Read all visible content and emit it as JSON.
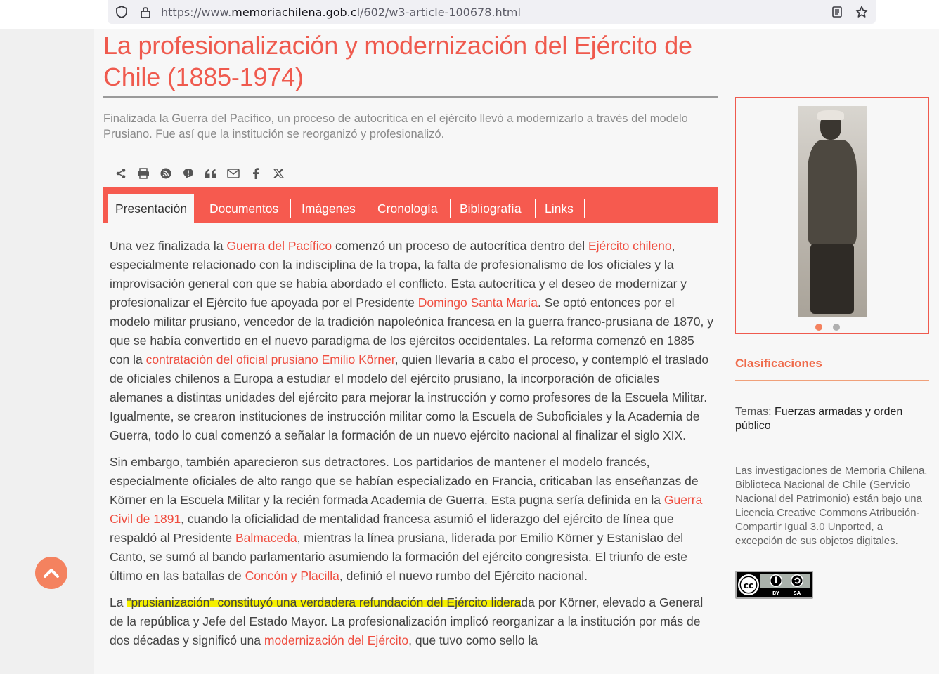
{
  "browser": {
    "url_prefix": "https://www.",
    "url_domain": "memoriachilena.gob.cl",
    "url_path": "/602/w3-article-100678.html"
  },
  "article": {
    "title": "La profesionalización y modernización del Ejército de Chile (1885-1974)",
    "summary": "Finalizada la Guerra del Pacífico, un proceso de autocrítica en el ejército llevó a modernizarlo a través del modelo Prusiano. Fue así que la institución se reorganizó y profesionalizó.",
    "actions": [
      "share-icon",
      "print-icon",
      "rss-icon",
      "alert-icon",
      "quote-icon",
      "mail-icon",
      "facebook-icon",
      "x-icon"
    ],
    "tabs": [
      "Presentación",
      "Documentos",
      "Imágenes",
      "Cronología",
      "Bibliografía",
      "Links"
    ],
    "p1": {
      "t1": "Una vez finalizada la ",
      "l1": "Guerra del Pacífico",
      "t2": " comenzó un proceso de autocrítica dentro del ",
      "l2": "Ejército chileno",
      "t3": ", especialmente relacionado con la indisciplina de la tropa, la falta de profesionalismo de los oficiales y la improvisación general con que se había abordado el conflicto. Esta autocrítica y el deseo de modernizar y profesionalizar el Ejército fue apoyada por el Presidente ",
      "l3": "Domingo Santa María",
      "t4": ". Se optó entonces por el modelo militar prusiano, vencedor de la tradición napoleónica francesa en la guerra franco-prusiana de 1870, y que se había convertido en el nuevo paradigma de los ejércitos occidentales. La reforma comenzó en 1885 con la ",
      "l4": "contratación del oficial prusiano Emilio Körner",
      "t5": ", quien llevaría a cabo el proceso, y contempló el traslado de oficiales chilenos a Europa a estudiar el modelo del ejército prusiano, la incorporación de oficiales alemanes a distintas unidades del ejército para mejorar la instrucción y como profesores de la Escuela Militar. Igualmente, se crearon instituciones de instrucción militar como la Escuela de Suboficiales y la Academia de Guerra, todo lo cual comenzó a señalar la formación de un nuevo ejército nacional al finalizar el siglo XIX."
    },
    "p2": {
      "t1": "Sin embargo, también aparecieron sus detractores. Los partidarios de mantener el modelo francés, especialmente oficiales de alto rango que se habían especializado en Francia, criticaban las enseñanzas de Körner en la Escuela Militar y la recién formada Academia de Guerra. Esta pugna sería definida en la ",
      "l1": "Guerra Civil de 1891",
      "t2": ", cuando la oficialidad de mentalidad francesa asumió el liderazgo del ejército de línea que respaldó al Presidente ",
      "l2": "Balmaceda",
      "t3": ", mientras la línea prusiana, liderada por Emilio Körner y Estanislao del Canto, se sumó al bando parlamentario asumiendo la formación del ejército congresista. El triunfo de este último en las batallas de ",
      "l3": "Concón y Placilla",
      "t4": ", definió el nuevo rumbo del Ejército nacional."
    },
    "p3": {
      "t1": "La ",
      "hl": "\"prusianización\" constituyó una verdadera refundación del Ejército lidera",
      "t2": "da por Körner, elevado a General de la república y Jefe del Estado Mayor. La profesionalización implicó reorganizar a la institución por más de dos décadas y significó una ",
      "l1": "modernización del Ejército",
      "t3": ", que tuvo como sello la"
    }
  },
  "sidebar": {
    "gallery_dots": 2,
    "active_dot": 0,
    "classifications_title": "Clasificaciones",
    "temas_label": "Temas: ",
    "temas_value": "Fuerzas armadas y orden público",
    "license_text": "Las investigaciones de Memoria Chilena, Biblioteca Nacional de Chile (Servicio Nacional del Patrimonio) están bajo una Licencia Creative Commons Atribución-Compartir Igual 3.0 Unported, a excepción de sus objetos digitales.",
    "cc_by": "BY",
    "cc_sa": "SA"
  },
  "colors": {
    "accent": "#ef5a4e",
    "tab_bar": "#f65a4f",
    "link": "#ef4d3f",
    "dot_active": "#f4825f",
    "dot_inactive": "#b0b0b0"
  }
}
